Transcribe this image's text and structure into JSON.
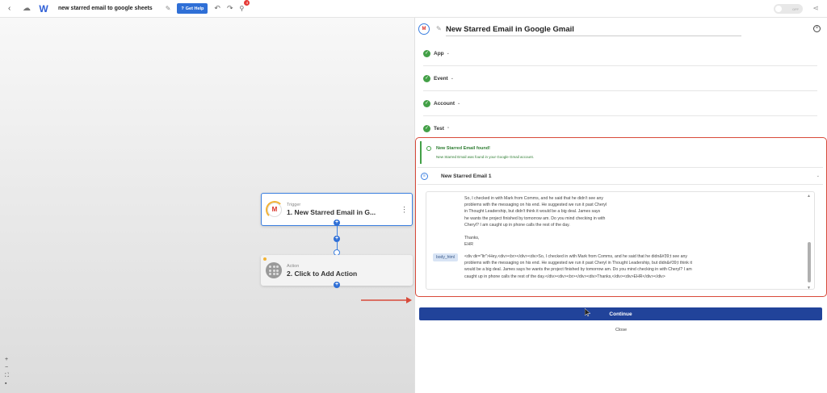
{
  "topbar": {
    "workflow_name": "new starred email to google sheets",
    "get_help_label": "Get Help",
    "notification_count": "4",
    "toggle_label": "OFF"
  },
  "canvas": {
    "trigger": {
      "subtitle": "Trigger",
      "title": "1. New Starred Email in G..."
    },
    "action": {
      "subtitle": "Action",
      "title": "2. Click to Add Action"
    },
    "zoom": {
      "in": "+",
      "out": "−"
    }
  },
  "panel": {
    "title": "New Starred Email in Google Gmail",
    "steps": [
      {
        "label": "App"
      },
      {
        "label": "Event"
      },
      {
        "label": "Account"
      },
      {
        "label": "Test"
      }
    ],
    "test": {
      "found_title": "New Starred Email found!",
      "found_subtitle": "New Starred Email was found in your Google Gmail account.",
      "record_label": "New Starred Email 1",
      "body_lines": [
        "So, I checked in with Mark from Comms, and he said that he didn't see any",
        "problems with the messaging on his end.  He suggested we run it past Cheryl",
        "in Thought Leadership, but didn't think it would be a big deal.  James says",
        "he wants the project finished by tomorrow am.  Do you mind checking in with",
        "Cheryl?  I am caught up in phone calls the rest of the day.",
        "",
        "Thanks,",
        "EHR"
      ],
      "body_html_key": "body_html",
      "body_html_lines": [
        "<div dir=\"ltr\">Hey,<div><br></div><div>So, I checked in with Mark from Comms, and he said that he didn&#39;t see any",
        "problems with the messaging on his end.  He suggested we run it past Cheryl in Thought Leadership, but didn&#39;t think it",
        "would be a big deal.  James says he wants the project finished by tomorrow am.  Do you mind checking in with Cheryl?  I am",
        "caught up in phone calls the rest of the day.</div><div><br></div><div>Thanks,</div><div>EHR</div></div>"
      ]
    },
    "continue_label": "Continue",
    "close_label": "Close"
  },
  "colors": {
    "primary": "#21439a",
    "accent_blue": "#2f6fd6",
    "success": "#43a047",
    "highlight_border": "#d84a3a"
  }
}
